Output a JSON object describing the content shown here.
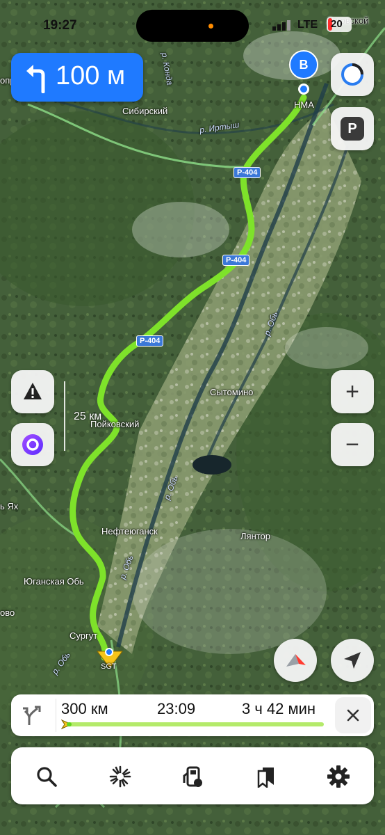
{
  "status_bar": {
    "time": "19:27",
    "network": "LTE",
    "battery": "20"
  },
  "maneuver": {
    "direction_icon": "turn-left-arrow-icon",
    "distance": "100 м",
    "color": "#1f7aff"
  },
  "map": {
    "destination_marker": "B",
    "scale_label": "25 км",
    "labels": {
      "sibirsky": "Сибирский",
      "konda": "р. Конда",
      "irtysh": "р. Иртыш",
      "hma": "НМА",
      "lugovskoy": "Луговской",
      "sytomino": "Сытомино",
      "poykovsky": "Пойковский",
      "nefteyugansk": "Нефтеюганск",
      "lyantor": "Лянтор",
      "yuganskaya_ob": "Юганская Обь",
      "surgut": "Сургут",
      "ob1": "р. Обь",
      "ob2": "р. Обь",
      "ob3": "р. Обь",
      "ob4": "р. Обь",
      "yakh": "ь Ях",
      "ovo": "ово",
      "opp": "опр",
      "sgt": "SGT"
    },
    "road_badges": [
      "Р-404",
      "Р-404",
      "Р-404"
    ],
    "route_color": "#7ee22a"
  },
  "route": {
    "distance": "300 км",
    "arrival": "23:09",
    "duration": "3 ч 42 мин",
    "progress": 0.02,
    "close_icon": "close-icon"
  },
  "side_buttons": {
    "alice": "alice-assistant-icon",
    "parking": "P",
    "warning": "road-warning-icon",
    "voice": "alice-voice-icon",
    "zoom_in": "+",
    "zoom_out": "−",
    "compass": "compass-icon",
    "locate": "location-arrow-icon"
  },
  "bottom_tabs": [
    {
      "name": "search",
      "icon": "search-icon"
    },
    {
      "name": "discover",
      "icon": "sparkle-icon"
    },
    {
      "name": "fuel",
      "icon": "fuel-station-icon"
    },
    {
      "name": "bookmarks",
      "icon": "bookmarks-icon"
    },
    {
      "name": "settings",
      "icon": "gear-icon"
    }
  ]
}
